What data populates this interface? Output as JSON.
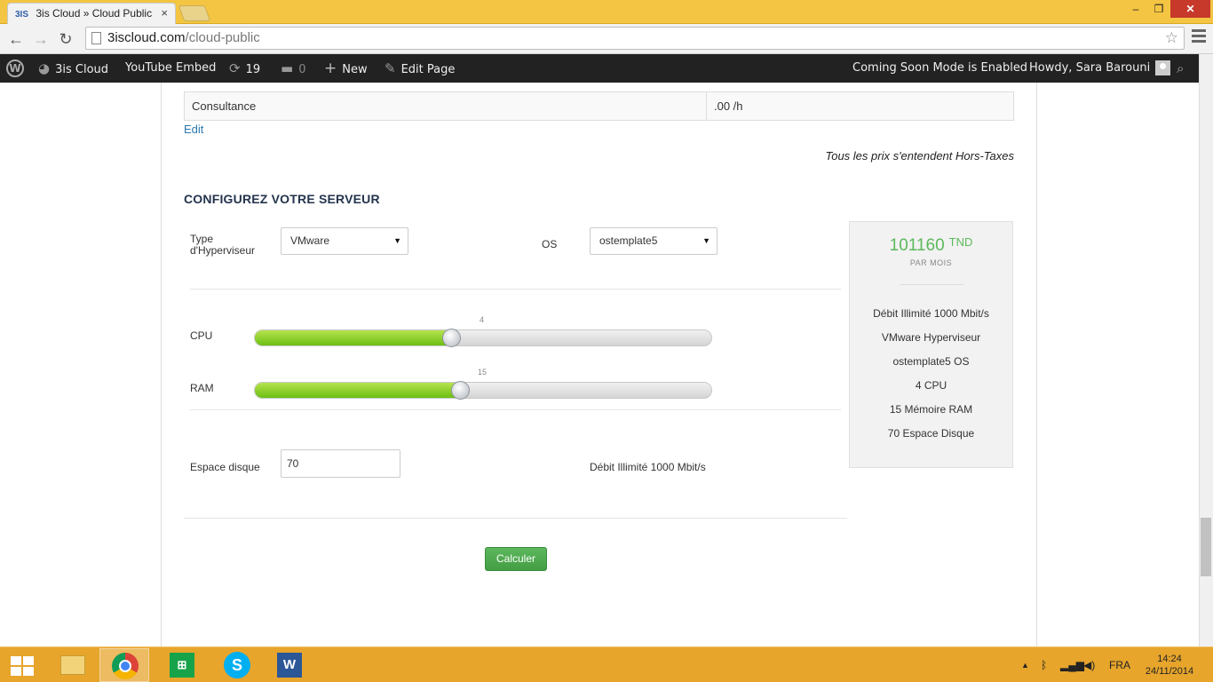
{
  "browser": {
    "tab_title": "3is Cloud » Cloud Public",
    "tab_icon": "3IS",
    "tab_close": "×",
    "url_domain": "3iscloud.com",
    "url_path": "/cloud-public",
    "window_min": "‒",
    "window_max": "❐",
    "window_close": "✕"
  },
  "adminbar": {
    "site_name": "3is Cloud",
    "youtube_embed": "YouTube Embed",
    "updates_count": "19",
    "comments_count": "0",
    "new_label": "New",
    "edit_page": "Edit Page",
    "coming_soon": "Coming Soon Mode is Enabled",
    "howdy": "Howdy, Sara Barouni"
  },
  "pricing_table": {
    "row_label": "Consultance",
    "row_value": ".00 /h",
    "edit_link": "Edit",
    "tax_note": "Tous les prix s'entendent Hors-Taxes"
  },
  "configurator": {
    "title": "CONFIGUREZ VOTRE SERVEUR",
    "hypervisor_label_line1": "Type",
    "hypervisor_label_line2": "d'Hyperviseur",
    "hypervisor_value": "VMware",
    "os_label": "OS",
    "os_value": "ostemplate5",
    "cpu_label": "CPU",
    "cpu_value": "4",
    "cpu_fill_fraction": 0.43,
    "ram_label": "RAM",
    "ram_value": "15",
    "ram_fill_fraction": 0.45,
    "disk_label": "Espace disque",
    "disk_value": "70",
    "bandwidth_note": "Débit Illimité 1000 Mbit/s",
    "calc_button": "Calculer"
  },
  "summary": {
    "price": "101160",
    "currency": "TND",
    "period": "PAR MOIS",
    "features": [
      "Débit Illimité 1000 Mbit/s",
      "VMware Hyperviseur",
      "ostemplate5 OS",
      "4 CPU",
      "15 Mémoire RAM",
      "70 Espace Disque"
    ]
  },
  "taskbar": {
    "language": "FRA",
    "time": "14:24",
    "date": "24/11/2014"
  },
  "colors": {
    "accent_green": "#5cb85c",
    "slider_green": "#8fd12b",
    "adminbar_bg": "#222222",
    "taskbar_bg": "#e7a52c"
  }
}
